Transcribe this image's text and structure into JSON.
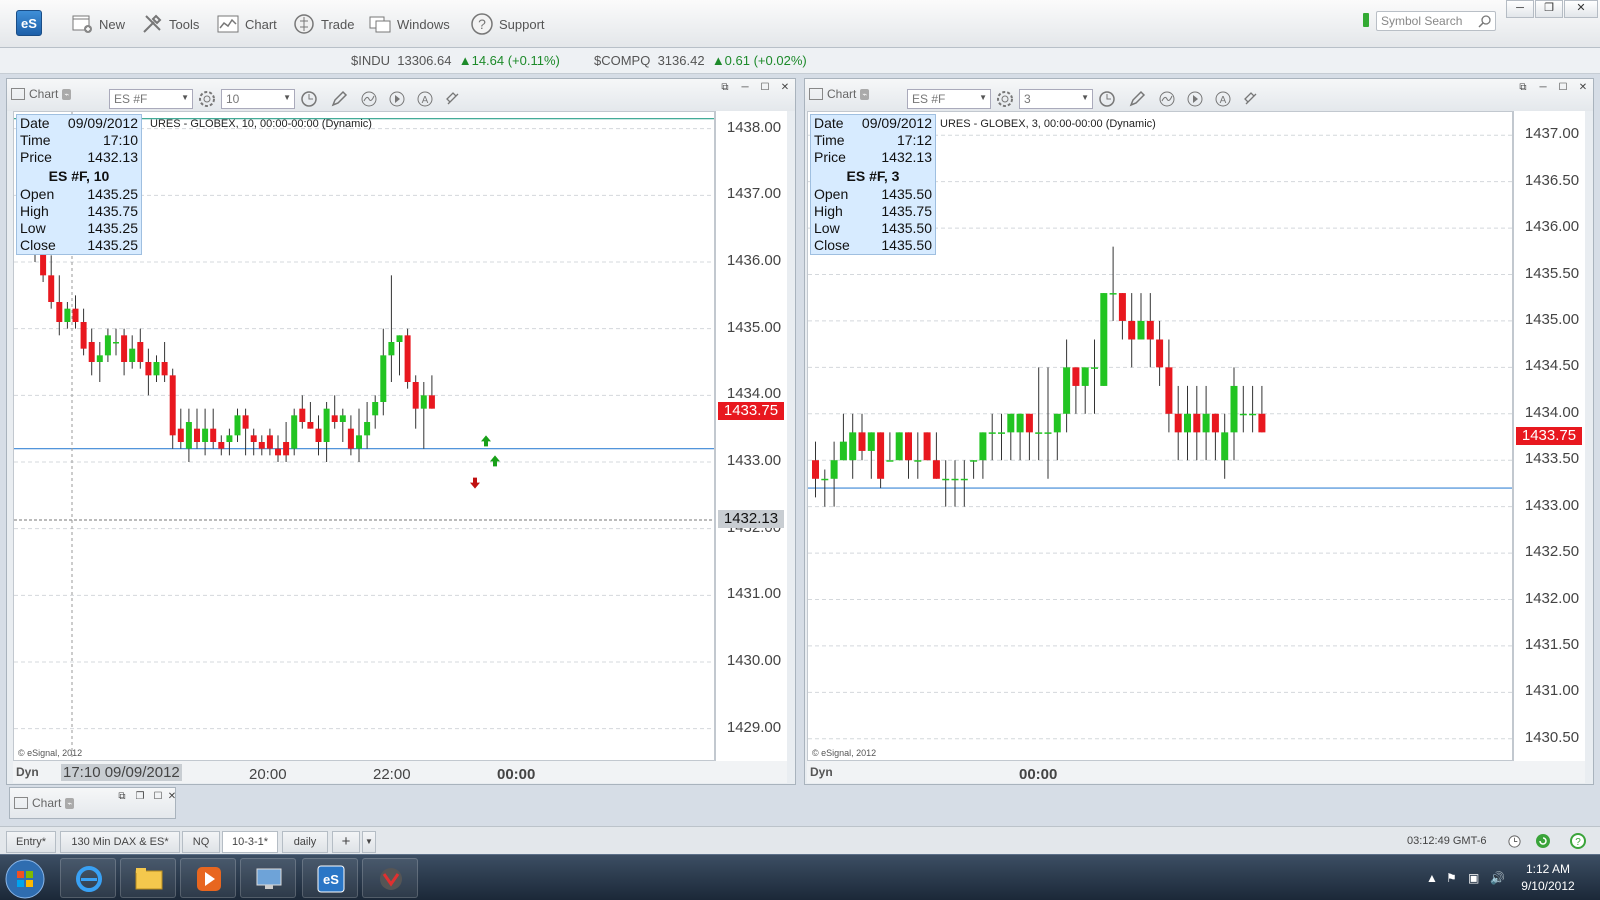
{
  "toolbar": {
    "logo": "eS",
    "items": [
      {
        "label": "New",
        "icon": "new-window-icon"
      },
      {
        "label": "Tools",
        "icon": "tools-icon"
      },
      {
        "label": "Chart",
        "icon": "chart-icon"
      },
      {
        "label": "Trade",
        "icon": "trade-icon"
      },
      {
        "label": "Windows",
        "icon": "windows-icon"
      },
      {
        "label": "Support",
        "icon": "support-icon"
      }
    ],
    "search_placeholder": "Symbol Search"
  },
  "ticker": [
    {
      "symbol": "$INDU",
      "price": "13306.64",
      "change": "▲14.64 (+0.11%)"
    },
    {
      "symbol": "$COMPQ",
      "price": "3136.42",
      "change": "▲0.61 (+0.02%)"
    }
  ],
  "colors": {
    "up": "#22c422",
    "down": "#e8181f",
    "cursor": "#e8181f",
    "hline": "#3a86d6",
    "accent": "#1d5fa8"
  },
  "charts": [
    {
      "title": "Chart",
      "symbol": "ES #F",
      "interval": "10",
      "description": "URES - GLOBEX, 10, 00:00-00:00 (Dynamic)",
      "info": {
        "date": "09/09/2012",
        "time": "17:10",
        "price": "1432.13",
        "symbol_label": "ES #F, 10",
        "open": "1435.25",
        "high": "1435.75",
        "low": "1435.25",
        "close": "1435.25"
      },
      "copyright": "© eSignal, 2012",
      "last_price": "1433.75",
      "cursor_price": "1432.13",
      "y_labels": [
        "1438.00",
        "1437.00",
        "1436.00",
        "1435.00",
        "1434.00",
        "1433.00",
        "1432.00",
        "1431.00",
        "1430.00",
        "1429.00"
      ],
      "x_labels": [
        "17:10 09/09/2012",
        "20:00",
        "22:00",
        "00:00"
      ],
      "dyn": "Dyn"
    },
    {
      "title": "Chart",
      "symbol": "ES #F",
      "interval": "3",
      "description": "URES - GLOBEX, 3, 00:00-00:00 (Dynamic)",
      "info": {
        "date": "09/09/2012",
        "time": "17:12",
        "price": "1432.13",
        "symbol_label": "ES #F, 3",
        "open": "1435.50",
        "high": "1435.75",
        "low": "1435.50",
        "close": "1435.50"
      },
      "copyright": "© eSignal, 2012",
      "last_price": "1433.75",
      "y_labels": [
        "1437.00",
        "1436.50",
        "1436.00",
        "1435.50",
        "1435.00",
        "1434.50",
        "1434.00",
        "1433.50",
        "1433.00",
        "1432.50",
        "1432.00",
        "1431.50",
        "1431.00",
        "1430.50"
      ],
      "x_labels": [
        "00:00"
      ],
      "dyn": "Dyn"
    }
  ],
  "info_labels": {
    "date": "Date",
    "time": "Time",
    "price": "Price",
    "open": "Open",
    "high": "High",
    "low": "Low",
    "close": "Close"
  },
  "mini_chart": {
    "title": "Chart"
  },
  "tabs": [
    "Entry*",
    "130 Min DAX & ES*",
    "NQ",
    "10-3-1*",
    "daily",
    "+"
  ],
  "status_clock": "03:12:49 GMT-6",
  "system_clock": {
    "time": "1:12 AM",
    "date": "9/10/2012"
  },
  "chart_data": [
    {
      "type": "candlestick",
      "symbol": "ES #F",
      "interval": "10",
      "ylim": [
        1428.5,
        1438.25
      ],
      "horizontal_lines": [
        1438.15,
        1433.2
      ],
      "candles": [
        [
          1436.4,
          1436.6,
          1436.0,
          1436.2
        ],
        [
          1436.2,
          1436.3,
          1435.7,
          1435.8
        ],
        [
          1435.8,
          1436.1,
          1435.3,
          1435.4
        ],
        [
          1435.4,
          1435.8,
          1434.9,
          1435.1
        ],
        [
          1435.1,
          1435.4,
          1435.0,
          1435.3
        ],
        [
          1435.3,
          1435.5,
          1435.0,
          1435.1
        ],
        [
          1435.1,
          1435.3,
          1434.6,
          1434.7
        ],
        [
          1434.8,
          1435.0,
          1434.3,
          1434.5
        ],
        [
          1434.5,
          1434.8,
          1434.2,
          1434.6
        ],
        [
          1434.6,
          1435.0,
          1434.5,
          1434.9
        ],
        [
          1434.8,
          1435.0,
          1434.6,
          1434.8
        ],
        [
          1434.9,
          1435.0,
          1434.3,
          1434.5
        ],
        [
          1434.5,
          1434.9,
          1434.4,
          1434.7
        ],
        [
          1434.8,
          1435.0,
          1434.4,
          1434.5
        ],
        [
          1434.5,
          1434.7,
          1434.0,
          1434.3
        ],
        [
          1434.3,
          1434.6,
          1434.2,
          1434.5
        ],
        [
          1434.5,
          1434.8,
          1434.2,
          1434.3
        ],
        [
          1434.3,
          1434.4,
          1433.2,
          1433.4
        ],
        [
          1433.5,
          1433.8,
          1433.2,
          1433.3
        ],
        [
          1433.2,
          1433.8,
          1433.0,
          1433.6
        ],
        [
          1433.5,
          1433.8,
          1433.2,
          1433.3
        ],
        [
          1433.3,
          1433.8,
          1433.1,
          1433.5
        ],
        [
          1433.5,
          1433.8,
          1433.2,
          1433.3
        ],
        [
          1433.3,
          1433.4,
          1433.1,
          1433.2
        ],
        [
          1433.3,
          1433.5,
          1433.1,
          1433.4
        ],
        [
          1433.4,
          1433.8,
          1433.3,
          1433.7
        ],
        [
          1433.7,
          1433.8,
          1433.1,
          1433.5
        ],
        [
          1433.4,
          1433.5,
          1433.1,
          1433.3
        ],
        [
          1433.3,
          1433.4,
          1433.1,
          1433.2
        ],
        [
          1433.4,
          1433.5,
          1433.1,
          1433.2
        ],
        [
          1433.2,
          1433.4,
          1433.0,
          1433.1
        ],
        [
          1433.3,
          1433.6,
          1433.0,
          1433.1
        ],
        [
          1433.2,
          1433.8,
          1433.1,
          1433.7
        ],
        [
          1433.8,
          1434.0,
          1433.5,
          1433.6
        ],
        [
          1433.6,
          1433.9,
          1433.5,
          1433.5
        ],
        [
          1433.5,
          1433.7,
          1433.1,
          1433.3
        ],
        [
          1433.3,
          1433.9,
          1433.0,
          1433.8
        ],
        [
          1433.7,
          1434.0,
          1433.5,
          1433.6
        ],
        [
          1433.6,
          1433.8,
          1433.3,
          1433.7
        ],
        [
          1433.5,
          1433.7,
          1433.1,
          1433.2
        ],
        [
          1433.2,
          1433.8,
          1433.0,
          1433.4
        ],
        [
          1433.4,
          1433.9,
          1433.2,
          1433.6
        ],
        [
          1433.7,
          1434.0,
          1433.5,
          1433.9
        ],
        [
          1433.9,
          1435.0,
          1433.7,
          1434.6
        ],
        [
          1434.6,
          1435.8,
          1434.2,
          1434.8
        ],
        [
          1434.8,
          1434.9,
          1434.3,
          1434.9
        ],
        [
          1434.9,
          1435.0,
          1434.1,
          1434.2
        ],
        [
          1434.2,
          1434.3,
          1433.5,
          1433.8
        ],
        [
          1433.8,
          1434.2,
          1433.2,
          1434.0
        ],
        [
          1434.0,
          1434.3,
          1433.8,
          1433.8
        ]
      ]
    },
    {
      "type": "candlestick",
      "symbol": "ES #F",
      "interval": "3",
      "ylim": [
        1430.25,
        1437.25
      ],
      "horizontal_lines": [
        1433.2
      ],
      "candles": [
        [
          1433.5,
          1433.7,
          1433.1,
          1433.3
        ],
        [
          1433.3,
          1433.4,
          1433.0,
          1433.3
        ],
        [
          1433.3,
          1433.7,
          1433.0,
          1433.5
        ],
        [
          1433.5,
          1434.0,
          1433.5,
          1433.7
        ],
        [
          1433.5,
          1434.0,
          1433.3,
          1433.8
        ],
        [
          1433.8,
          1434.0,
          1433.5,
          1433.6
        ],
        [
          1433.6,
          1433.8,
          1433.3,
          1433.8
        ],
        [
          1433.8,
          1433.8,
          1433.2,
          1433.3
        ],
        [
          1433.5,
          1433.8,
          1433.5,
          1433.5
        ],
        [
          1433.5,
          1433.8,
          1433.5,
          1433.8
        ],
        [
          1433.8,
          1433.8,
          1433.3,
          1433.5
        ],
        [
          1433.5,
          1433.8,
          1433.3,
          1433.5
        ],
        [
          1433.8,
          1433.8,
          1433.5,
          1433.5
        ],
        [
          1433.5,
          1433.8,
          1433.3,
          1433.3
        ],
        [
          1433.3,
          1433.5,
          1433.0,
          1433.3
        ],
        [
          1433.3,
          1433.5,
          1433.0,
          1433.3
        ],
        [
          1433.3,
          1433.5,
          1433.0,
          1433.3
        ],
        [
          1433.5,
          1433.5,
          1433.3,
          1433.5
        ],
        [
          1433.5,
          1433.8,
          1433.3,
          1433.8
        ],
        [
          1433.8,
          1434.0,
          1433.5,
          1433.8
        ],
        [
          1433.8,
          1434.0,
          1433.5,
          1433.8
        ],
        [
          1433.8,
          1434.0,
          1433.5,
          1434.0
        ],
        [
          1433.8,
          1434.0,
          1433.5,
          1434.0
        ],
        [
          1434.0,
          1434.0,
          1433.5,
          1433.8
        ],
        [
          1433.8,
          1434.5,
          1433.5,
          1433.8
        ],
        [
          1433.8,
          1434.5,
          1433.3,
          1433.8
        ],
        [
          1433.8,
          1434.0,
          1433.5,
          1434.0
        ],
        [
          1434.0,
          1434.8,
          1433.8,
          1434.5
        ],
        [
          1434.5,
          1434.5,
          1434.0,
          1434.3
        ],
        [
          1434.3,
          1434.5,
          1434.0,
          1434.5
        ],
        [
          1434.5,
          1434.8,
          1434.0,
          1434.5
        ],
        [
          1434.3,
          1435.3,
          1434.3,
          1435.3
        ],
        [
          1435.3,
          1435.8,
          1435.0,
          1435.3
        ],
        [
          1435.3,
          1435.3,
          1434.8,
          1435.0
        ],
        [
          1435.0,
          1435.3,
          1434.5,
          1434.8
        ],
        [
          1434.8,
          1435.3,
          1434.8,
          1435.0
        ],
        [
          1435.0,
          1435.3,
          1434.5,
          1434.8
        ],
        [
          1434.8,
          1435.0,
          1434.3,
          1434.5
        ],
        [
          1434.5,
          1434.8,
          1433.8,
          1434.0
        ],
        [
          1434.0,
          1434.3,
          1433.5,
          1433.8
        ],
        [
          1433.8,
          1434.3,
          1433.5,
          1434.0
        ],
        [
          1434.0,
          1434.3,
          1433.5,
          1433.8
        ],
        [
          1433.8,
          1434.3,
          1433.5,
          1434.0
        ],
        [
          1434.0,
          1434.0,
          1433.5,
          1433.8
        ],
        [
          1433.5,
          1434.0,
          1433.3,
          1433.8
        ],
        [
          1433.8,
          1434.5,
          1433.5,
          1434.3
        ],
        [
          1434.0,
          1434.3,
          1433.8,
          1434.0
        ],
        [
          1434.0,
          1434.3,
          1433.8,
          1434.0
        ],
        [
          1434.0,
          1434.3,
          1433.8,
          1433.8
        ]
      ]
    }
  ]
}
